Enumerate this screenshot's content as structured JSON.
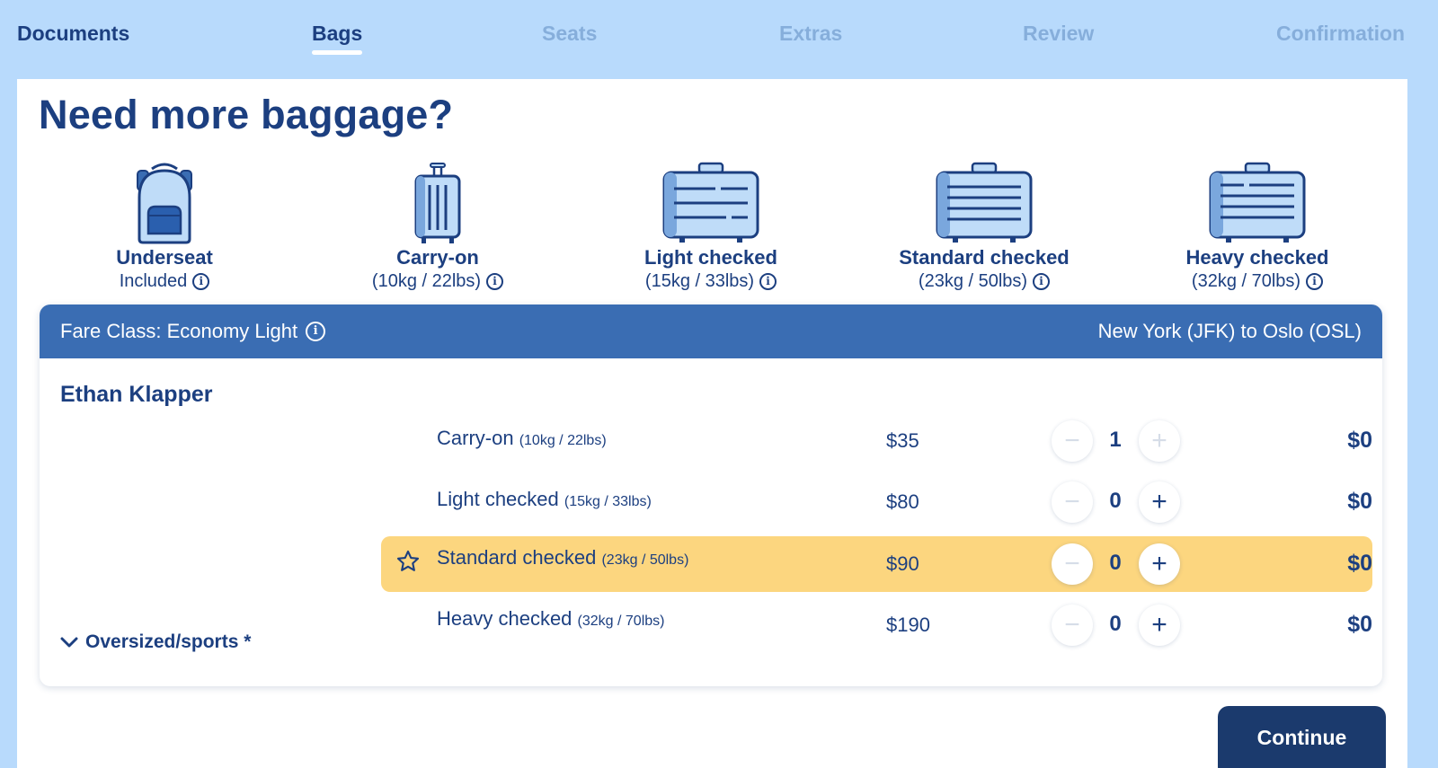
{
  "steps": [
    {
      "label": "Documents",
      "state": "done"
    },
    {
      "label": "Bags",
      "state": "active"
    },
    {
      "label": "Seats",
      "state": "todo"
    },
    {
      "label": "Extras",
      "state": "todo"
    },
    {
      "label": "Review",
      "state": "todo"
    },
    {
      "label": "Confirmation",
      "state": "todo"
    }
  ],
  "page_title": "Need more baggage?",
  "bag_types": [
    {
      "name": "Underseat",
      "detail": "Included",
      "icon": "backpack-icon"
    },
    {
      "name": "Carry-on",
      "detail": "(10kg / 22lbs)",
      "icon": "carry-on-suitcase-icon"
    },
    {
      "name": "Light checked",
      "detail": "(15kg / 33lbs)",
      "icon": "checked-suitcase-icon"
    },
    {
      "name": "Standard checked",
      "detail": "(23kg / 50lbs)",
      "icon": "checked-suitcase-icon"
    },
    {
      "name": "Heavy checked",
      "detail": "(32kg / 70lbs)",
      "icon": "checked-suitcase-icon"
    }
  ],
  "fare": {
    "class_label": "Fare Class: Economy Light",
    "route": "New York (JFK) to Oslo (OSL)"
  },
  "passenger": {
    "name": "Ethan Klapper",
    "oversized_label": "Oversized/sports *",
    "rows": [
      {
        "name": "Carry-on",
        "weight": "(10kg / 22lbs)",
        "price": "$35",
        "qty": "1",
        "total": "$0",
        "highlight": false,
        "plus_disabled": true
      },
      {
        "name": "Light checked",
        "weight": "(15kg / 33lbs)",
        "price": "$80",
        "qty": "0",
        "total": "$0",
        "highlight": false,
        "plus_disabled": false
      },
      {
        "name": "Standard checked",
        "weight": "(23kg / 50lbs)",
        "price": "$90",
        "qty": "0",
        "total": "$0",
        "highlight": true,
        "plus_disabled": false
      },
      {
        "name": "Heavy checked",
        "weight": "(32kg / 70lbs)",
        "price": "$190",
        "qty": "0",
        "total": "$0",
        "highlight": false,
        "plus_disabled": false
      }
    ]
  },
  "stepper": {
    "minus": "−",
    "plus": "+"
  },
  "continue_label": "Continue",
  "colors": {
    "background": "#b8dafc",
    "navy": "#1c3f80",
    "header_blue": "#3a6db3",
    "highlight": "#fcd67f",
    "inactive_step": "#86aedb",
    "button": "#1b3a6d"
  }
}
